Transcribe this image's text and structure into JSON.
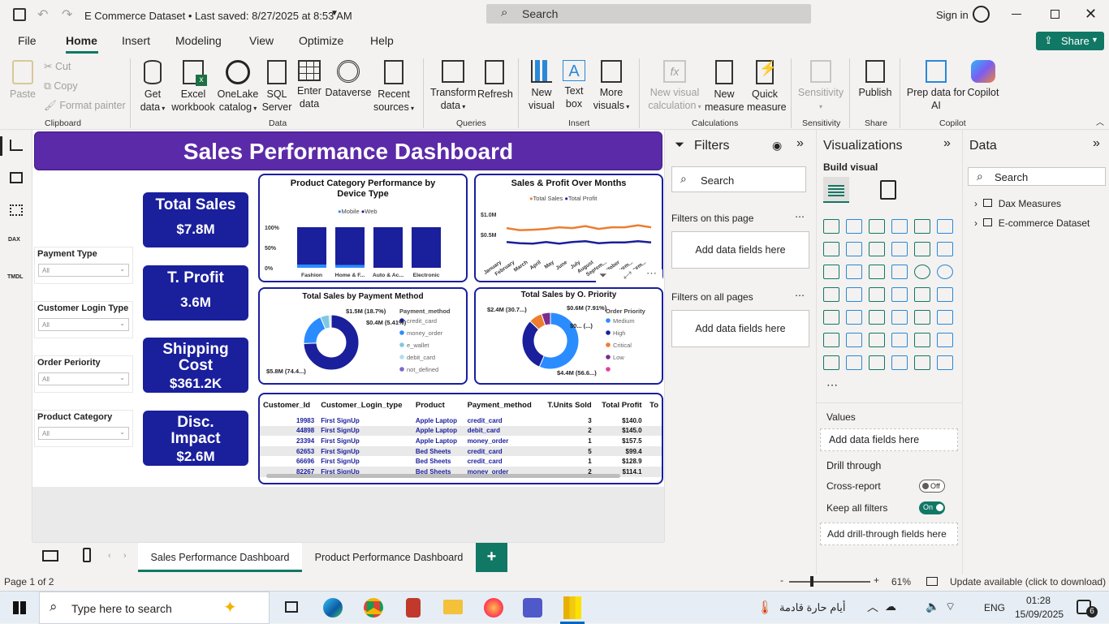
{
  "window": {
    "title": "E Commerce Dataset • Last saved: 8/27/2025 at 8:53 AM",
    "search_placeholder": "Search",
    "sign_in": "Sign in"
  },
  "menu": {
    "tabs": [
      "File",
      "Home",
      "Insert",
      "Modeling",
      "View",
      "Optimize",
      "Help"
    ],
    "active": "Home",
    "share": "Share"
  },
  "ribbon": {
    "clipboard": {
      "paste": "Paste",
      "cut": "Cut",
      "copy": "Copy",
      "format_painter": "Format painter",
      "group": "Clipboard"
    },
    "data": {
      "get_data": [
        "Get",
        "data"
      ],
      "excel": [
        "Excel",
        "workbook"
      ],
      "onelake": [
        "OneLake",
        "catalog"
      ],
      "sql": [
        "SQL",
        "Server"
      ],
      "enter": [
        "Enter",
        "data"
      ],
      "dataverse": "Dataverse",
      "recent": [
        "Recent",
        "sources"
      ],
      "group": "Data"
    },
    "queries": {
      "transform": [
        "Transform",
        "data"
      ],
      "refresh": "Refresh",
      "group": "Queries"
    },
    "insert": {
      "new_visual": [
        "New",
        "visual"
      ],
      "text_box": [
        "Text",
        "box"
      ],
      "more_visuals": [
        "More",
        "visuals"
      ],
      "group": "Insert"
    },
    "calculations": {
      "new_visual_calc": [
        "New visual",
        "calculation"
      ],
      "new_measure": [
        "New",
        "measure"
      ],
      "quick_measure": [
        "Quick",
        "measure"
      ],
      "group": "Calculations"
    },
    "sensitivity": {
      "label": "Sensitivity",
      "group": "Sensitivity"
    },
    "share": {
      "publish": "Publish",
      "group": "Share"
    },
    "copilot": {
      "prep": [
        "Prep data for",
        "AI"
      ],
      "copilot": "Copilot",
      "group": "Copilot"
    }
  },
  "report": {
    "title": "Sales Performance Dashboard",
    "slicers": [
      {
        "label": "Payment Type",
        "value": "All"
      },
      {
        "label": "Customer Login Type",
        "value": "All"
      },
      {
        "label": "Order Periority",
        "value": "All"
      },
      {
        "label": "Product Category",
        "value": "All"
      }
    ],
    "kpis": [
      {
        "label": "Total Sales",
        "value": "$7.8M"
      },
      {
        "label": "T. Profit",
        "value": "3.6M"
      },
      {
        "label": "Shipping Cost",
        "value": "$361.2K"
      },
      {
        "label": "Disc. Impact",
        "value": "$2.6M"
      }
    ],
    "table": {
      "columns": [
        "Customer_Id",
        "Customer_Login_type",
        "Product",
        "Payment_method",
        "T.Units Sold",
        "Total Profit",
        "To"
      ],
      "rows": [
        [
          "19983",
          "First SignUp",
          "Apple Laptop",
          "credit_card",
          "3",
          "$140.0"
        ],
        [
          "44898",
          "First SignUp",
          "Apple Laptop",
          "debit_card",
          "2",
          "$145.0"
        ],
        [
          "23394",
          "First SignUp",
          "Apple Laptop",
          "money_order",
          "1",
          "$157.5"
        ],
        [
          "62653",
          "First SignUp",
          "Bed Sheets",
          "credit_card",
          "5",
          "$99.4"
        ],
        [
          "66696",
          "First SignUp",
          "Bed Sheets",
          "credit_card",
          "1",
          "$128.9"
        ],
        [
          "82267",
          "First SignUp",
          "Bed Sheets",
          "money_order",
          "2",
          "$114.1"
        ]
      ]
    }
  },
  "chart_data": [
    {
      "type": "bar",
      "title": "Product Category Performance by Device Type",
      "categories": [
        "Fashion",
        "Home & F...",
        "Auto & Ac...",
        "Electronic"
      ],
      "series": [
        {
          "name": "Mobile",
          "values": [
            8,
            7,
            0,
            0
          ]
        },
        {
          "name": "Web",
          "values": [
            92,
            93,
            100,
            100
          ]
        }
      ],
      "ylim": [
        0,
        100
      ],
      "yticks": [
        "100%",
        "50%",
        "0%"
      ],
      "colors": {
        "Mobile": "#2b8cff",
        "Web": "#1a1f9c"
      }
    },
    {
      "type": "line",
      "title": "Sales & Profit Over Months",
      "categories": [
        "January",
        "February",
        "March",
        "April",
        "May",
        "June",
        "July",
        "August",
        "Septem...",
        "October",
        "Novem...",
        "Decem..."
      ],
      "series": [
        {
          "name": "Total Sales",
          "values": [
            0.66,
            0.61,
            0.62,
            0.64,
            0.68,
            0.66,
            0.71,
            0.64,
            0.68,
            0.68,
            0.73,
            0.68
          ]
        },
        {
          "name": "Total Profit",
          "values": [
            0.32,
            0.29,
            0.28,
            0.32,
            0.28,
            0.32,
            0.34,
            0.29,
            0.31,
            0.31,
            0.34,
            0.31
          ]
        }
      ],
      "ylim": [
        0,
        1.0
      ],
      "yticks": [
        "$1.0M",
        "$0.5M",
        "$0.0M"
      ],
      "colors": {
        "Total Sales": "#ed7d31",
        "Total Profit": "#1a1f9c"
      }
    },
    {
      "type": "pie",
      "title": "Total Sales by Payment Method",
      "legend_title": "Payment_method",
      "slices": [
        {
          "name": "credit_card",
          "value": 5.8,
          "label": "$5.8M (74.4...)",
          "color": "#1a1f9c"
        },
        {
          "name": "money_order",
          "value": 1.5,
          "label": "$1.5M (18.7%)",
          "color": "#2b8cff"
        },
        {
          "name": "e_wallet",
          "value": 0.4,
          "label": "$0.4M (5.41%)",
          "color": "#7ec8e3"
        },
        {
          "name": "debit_card",
          "value": 0.08,
          "label": "",
          "color": "#b4dcef"
        },
        {
          "name": "not_defined",
          "value": 0.02,
          "label": "",
          "color": "#7b68c9"
        }
      ]
    },
    {
      "type": "pie",
      "title": "Total Sales by O. Priority",
      "legend_title": "Order Priority",
      "slices": [
        {
          "name": "Medium",
          "value": 4.4,
          "label": "$4.4M (56.6...)",
          "color": "#2b8cff"
        },
        {
          "name": "High",
          "value": 2.4,
          "label": "$2.4M (30.7...)",
          "color": "#1a1f9c"
        },
        {
          "name": "Critical",
          "value": 0.6,
          "label": "$0.6M (7.91%)",
          "color": "#ed7d31"
        },
        {
          "name": "Low",
          "value": 0.4,
          "label": "$0... (...)",
          "color": "#7b2d8e"
        },
        {
          "name": "",
          "value": 0.0,
          "label": "",
          "color": "#e040a0"
        }
      ]
    }
  ],
  "filters_pane": {
    "title": "Filters",
    "search": "Search",
    "on_page": "Filters on this page",
    "on_all": "Filters on all pages",
    "add_fields": "Add data fields here"
  },
  "vis_pane": {
    "title": "Visualizations",
    "build": "Build visual",
    "values": "Values",
    "add_fields": "Add data fields here",
    "drill": "Drill through",
    "cross_report": "Cross-report",
    "cross_state": "Off",
    "keep_filters": "Keep all filters",
    "keep_state": "On",
    "add_drill": "Add drill-through fields here"
  },
  "data_pane": {
    "title": "Data",
    "search": "Search",
    "items": [
      "Dax Measures",
      "E-commerce Dataset"
    ]
  },
  "page_tabs": [
    "Sales Performance Dashboard",
    "Product Performance Dashboard"
  ],
  "status": {
    "page": "Page 1 of 2",
    "zoom": "61%",
    "update": "Update available (click to download)"
  },
  "taskbar": {
    "search": "Type here to search",
    "weather": "أيام حارة قادمة",
    "lang": "ENG",
    "time": "01:28",
    "date": "15/09/2025",
    "notif": "6"
  }
}
